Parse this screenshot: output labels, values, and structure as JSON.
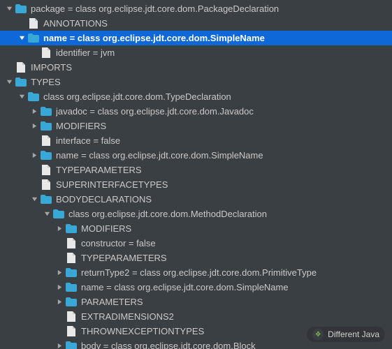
{
  "colors": {
    "selection": "#0f68d8",
    "folder": "#3aa8d6",
    "file": "#e8e8e8",
    "bg": "#3a3f44"
  },
  "watermark": "Different Java",
  "tree": [
    {
      "depth": 0,
      "arrow": "down",
      "icon": "folder",
      "label": "package = class org.eclipse.jdt.core.dom.PackageDeclaration",
      "interact": true,
      "selected": false
    },
    {
      "depth": 1,
      "arrow": "none",
      "icon": "file",
      "label": "ANNOTATIONS",
      "interact": true,
      "selected": false
    },
    {
      "depth": 1,
      "arrow": "down",
      "icon": "folder",
      "label": "name = class org.eclipse.jdt.core.dom.SimpleName",
      "interact": true,
      "selected": true
    },
    {
      "depth": 2,
      "arrow": "none",
      "icon": "file",
      "label": "identifier = jvm",
      "interact": true,
      "selected": false
    },
    {
      "depth": 0,
      "arrow": "none",
      "icon": "file",
      "label": "IMPORTS",
      "interact": true,
      "selected": false
    },
    {
      "depth": 0,
      "arrow": "down",
      "icon": "folder",
      "label": "TYPES",
      "interact": true,
      "selected": false
    },
    {
      "depth": 1,
      "arrow": "down",
      "icon": "folder",
      "label": "class org.eclipse.jdt.core.dom.TypeDeclaration",
      "interact": true,
      "selected": false
    },
    {
      "depth": 2,
      "arrow": "right",
      "icon": "folder",
      "label": "javadoc = class org.eclipse.jdt.core.dom.Javadoc",
      "interact": true,
      "selected": false
    },
    {
      "depth": 2,
      "arrow": "right",
      "icon": "folder",
      "label": "MODIFIERS",
      "interact": true,
      "selected": false
    },
    {
      "depth": 2,
      "arrow": "none",
      "icon": "file",
      "label": "interface = false",
      "interact": true,
      "selected": false
    },
    {
      "depth": 2,
      "arrow": "right",
      "icon": "folder",
      "label": "name = class org.eclipse.jdt.core.dom.SimpleName",
      "interact": true,
      "selected": false
    },
    {
      "depth": 2,
      "arrow": "none",
      "icon": "file",
      "label": "TYPEPARAMETERS",
      "interact": true,
      "selected": false
    },
    {
      "depth": 2,
      "arrow": "none",
      "icon": "file",
      "label": "SUPERINTERFACETYPES",
      "interact": true,
      "selected": false
    },
    {
      "depth": 2,
      "arrow": "down",
      "icon": "folder",
      "label": "BODYDECLARATIONS",
      "interact": true,
      "selected": false
    },
    {
      "depth": 3,
      "arrow": "down",
      "icon": "folder",
      "label": "class org.eclipse.jdt.core.dom.MethodDeclaration",
      "interact": true,
      "selected": false
    },
    {
      "depth": 4,
      "arrow": "right",
      "icon": "folder",
      "label": "MODIFIERS",
      "interact": true,
      "selected": false
    },
    {
      "depth": 4,
      "arrow": "none",
      "icon": "file",
      "label": "constructor = false",
      "interact": true,
      "selected": false
    },
    {
      "depth": 4,
      "arrow": "none",
      "icon": "file",
      "label": "TYPEPARAMETERS",
      "interact": true,
      "selected": false
    },
    {
      "depth": 4,
      "arrow": "right",
      "icon": "folder",
      "label": "returnType2 = class org.eclipse.jdt.core.dom.PrimitiveType",
      "interact": true,
      "selected": false
    },
    {
      "depth": 4,
      "arrow": "right",
      "icon": "folder",
      "label": "name = class org.eclipse.jdt.core.dom.SimpleName",
      "interact": true,
      "selected": false
    },
    {
      "depth": 4,
      "arrow": "right",
      "icon": "folder",
      "label": "PARAMETERS",
      "interact": true,
      "selected": false
    },
    {
      "depth": 4,
      "arrow": "none",
      "icon": "file",
      "label": "EXTRADIMENSIONS2",
      "interact": true,
      "selected": false
    },
    {
      "depth": 4,
      "arrow": "none",
      "icon": "file",
      "label": "THROWNEXCEPTIONTYPES",
      "interact": true,
      "selected": false
    },
    {
      "depth": 4,
      "arrow": "right",
      "icon": "folder",
      "label": "body = class org.eclipse.jdt.core.dom.Block",
      "interact": true,
      "selected": false
    }
  ]
}
